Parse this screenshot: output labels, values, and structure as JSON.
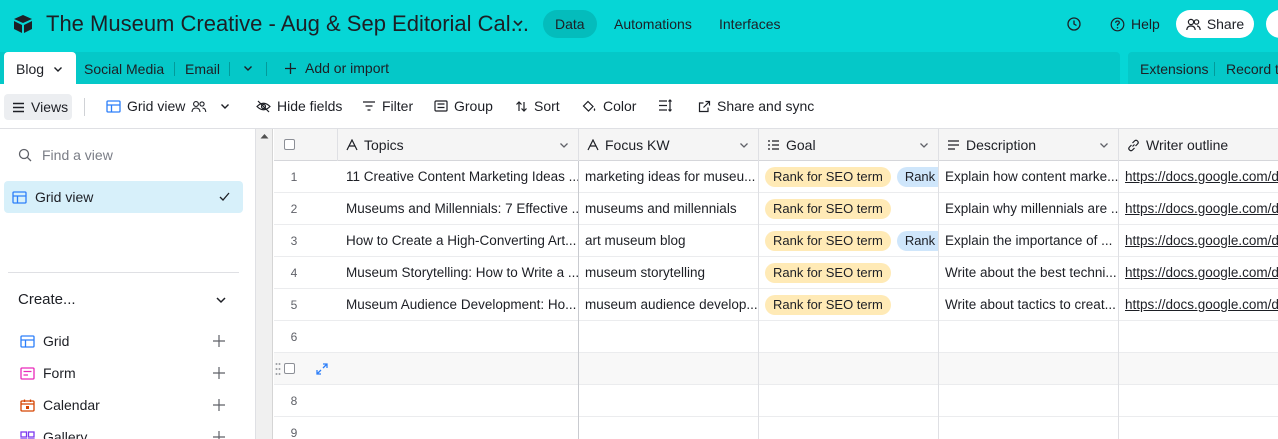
{
  "header": {
    "base_title": "The Museum Creative - Aug & Sep Editorial Cal...",
    "nav": [
      "Data",
      "Automations",
      "Interfaces"
    ],
    "help_label": "Help",
    "share_label": "Share",
    "accent_color": "#06d6d6"
  },
  "tables": {
    "tabs": [
      "Blog",
      "Social Media",
      "Email"
    ],
    "add_import": "Add or import",
    "extensions": "Extensions",
    "record_templates": "Record te"
  },
  "toolbar": {
    "views": "Views",
    "grid_view": "Grid view",
    "hide_fields": "Hide fields",
    "filter": "Filter",
    "group": "Group",
    "sort": "Sort",
    "color": "Color",
    "share_sync": "Share and sync"
  },
  "sidebar": {
    "find_placeholder": "Find a view",
    "active_view": "Grid view",
    "create_label": "Create...",
    "create_items": [
      "Grid",
      "Form",
      "Calendar",
      "Gallery"
    ]
  },
  "grid": {
    "columns": [
      "Topics",
      "Focus KW",
      "Goal",
      "Description",
      "Writer outline"
    ],
    "rows": [
      {
        "num": "1",
        "topic": "11 Creative Content Marketing Ideas ...",
        "kw": "marketing ideas for museu...",
        "goal1": "Rank for SEO term",
        "goal2": "Rank fo",
        "desc": "Explain how content marke...",
        "outline": "https://docs.google.com/d"
      },
      {
        "num": "2",
        "topic": "Museums and Millennials: 7 Effective ...",
        "kw": "museums and millennials",
        "goal1": "Rank for SEO term",
        "goal2": "",
        "desc": "Explain why millennials are ...",
        "outline": "https://docs.google.com/d"
      },
      {
        "num": "3",
        "topic": "How to Create a High-Converting Art...",
        "kw": "art museum blog",
        "goal1": "Rank for SEO term",
        "goal2": "Rank fo",
        "desc": "Explain the importance of ...",
        "outline": "https://docs.google.com/d"
      },
      {
        "num": "4",
        "topic": "Museum Storytelling: How to Write a ...",
        "kw": "museum storytelling",
        "goal1": "Rank for SEO term",
        "goal2": "",
        "desc": "Write about the best techni...",
        "outline": "https://docs.google.com/d"
      },
      {
        "num": "5",
        "topic": "Museum Audience Development: Ho...",
        "kw": "museum audience develop...",
        "goal1": "Rank for SEO term",
        "goal2": "",
        "desc": "Write about tactics to creat...",
        "outline": "https://docs.google.com/d"
      }
    ],
    "empty_rows": [
      "6",
      "",
      "8",
      "9"
    ]
  }
}
